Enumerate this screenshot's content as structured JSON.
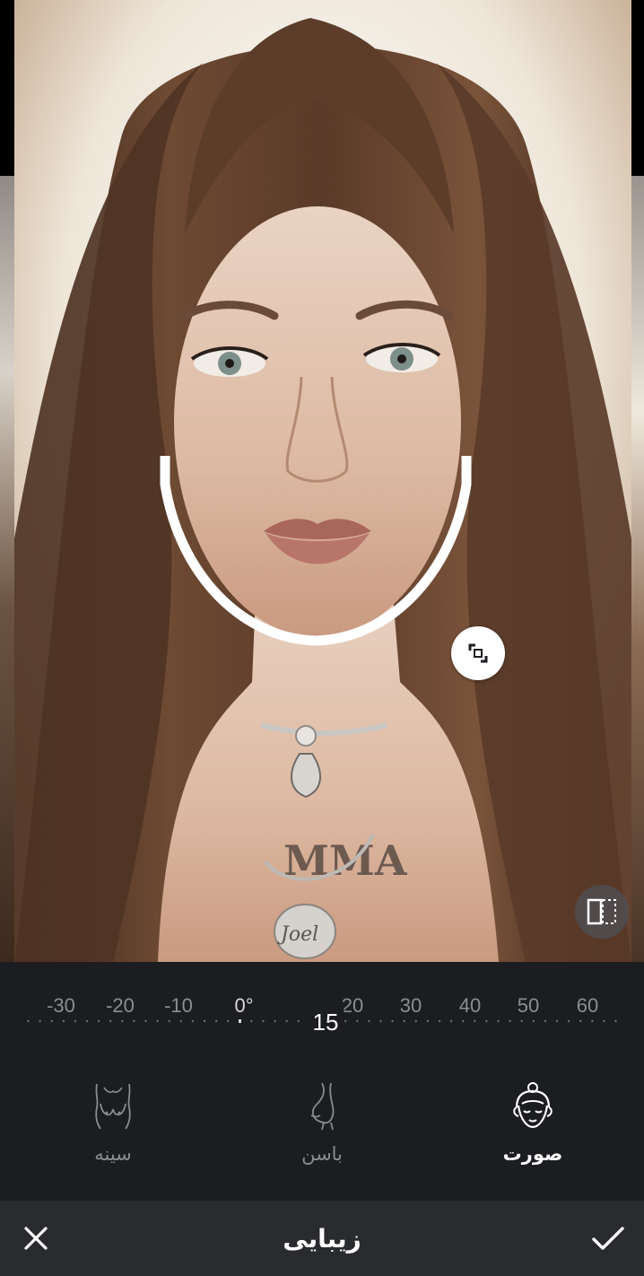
{
  "photo": {
    "necklace_tag_text": "Joel",
    "chest_tattoo_text": "MMA"
  },
  "ruler": {
    "ticks": [
      "-30",
      "-20",
      "-10",
      "0°",
      "20",
      "30",
      "40",
      "50",
      "60"
    ],
    "current_value": "15",
    "min": -30,
    "max": 60,
    "value": 15
  },
  "tabs": [
    {
      "id": "chest",
      "label": "سینه",
      "icon": "chest-icon",
      "active": false
    },
    {
      "id": "hips",
      "label": "باسن",
      "icon": "hips-icon",
      "active": false
    },
    {
      "id": "face",
      "label": "صورت",
      "icon": "face-icon",
      "active": true
    }
  ],
  "action_bar": {
    "title": "زیبایی",
    "close_icon": "close-icon",
    "apply_icon": "check-icon"
  },
  "overlay": {
    "handle_icon": "resize-icon",
    "compare_icon": "compare-icon"
  },
  "colors": {
    "panel_bg": "#1c1d20",
    "action_bar_bg": "#2a2b2e",
    "active_text": "#ffffff",
    "inactive_text": "#8a8b90",
    "overlay_stroke": "#ffffff"
  }
}
